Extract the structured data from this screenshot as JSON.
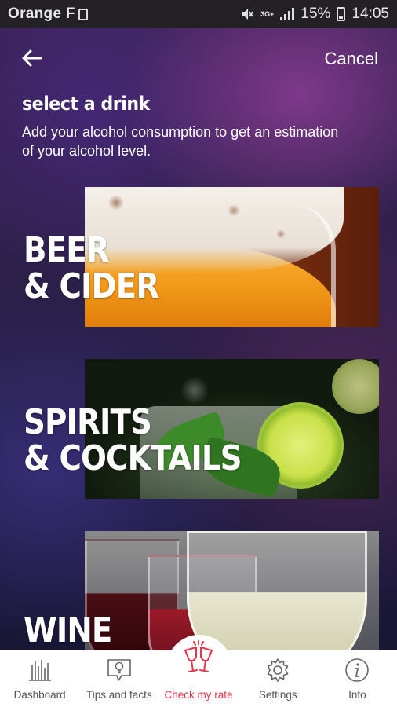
{
  "status_bar": {
    "carrier": "Orange F",
    "network": "3G+",
    "battery": "15%",
    "time": "14:05"
  },
  "header": {
    "back_icon": "arrow-left-icon",
    "cancel_label": "Cancel"
  },
  "page": {
    "title": "select a drink",
    "subtitle": "Add your alcohol consumption to get an estimation of your alcohol level."
  },
  "drinks": [
    {
      "line1": "BEER",
      "line2": "& CIDER"
    },
    {
      "line1": "SPIRITS",
      "line2": "& COCKTAILS"
    },
    {
      "line1": "WINE"
    }
  ],
  "nav": {
    "items": [
      {
        "label": "Dashboard",
        "icon": "bar-chart-icon"
      },
      {
        "label": "Tips and facts",
        "icon": "lightbulb-chat-icon"
      },
      {
        "label": "Check my rate",
        "icon": "cheers-glasses-icon",
        "active": true
      },
      {
        "label": "Settings",
        "icon": "gear-icon"
      },
      {
        "label": "Info",
        "icon": "info-icon"
      }
    ]
  },
  "colors": {
    "accent": "#e8334a",
    "nav_text": "#555555",
    "status_bar_bg": "#232026"
  }
}
